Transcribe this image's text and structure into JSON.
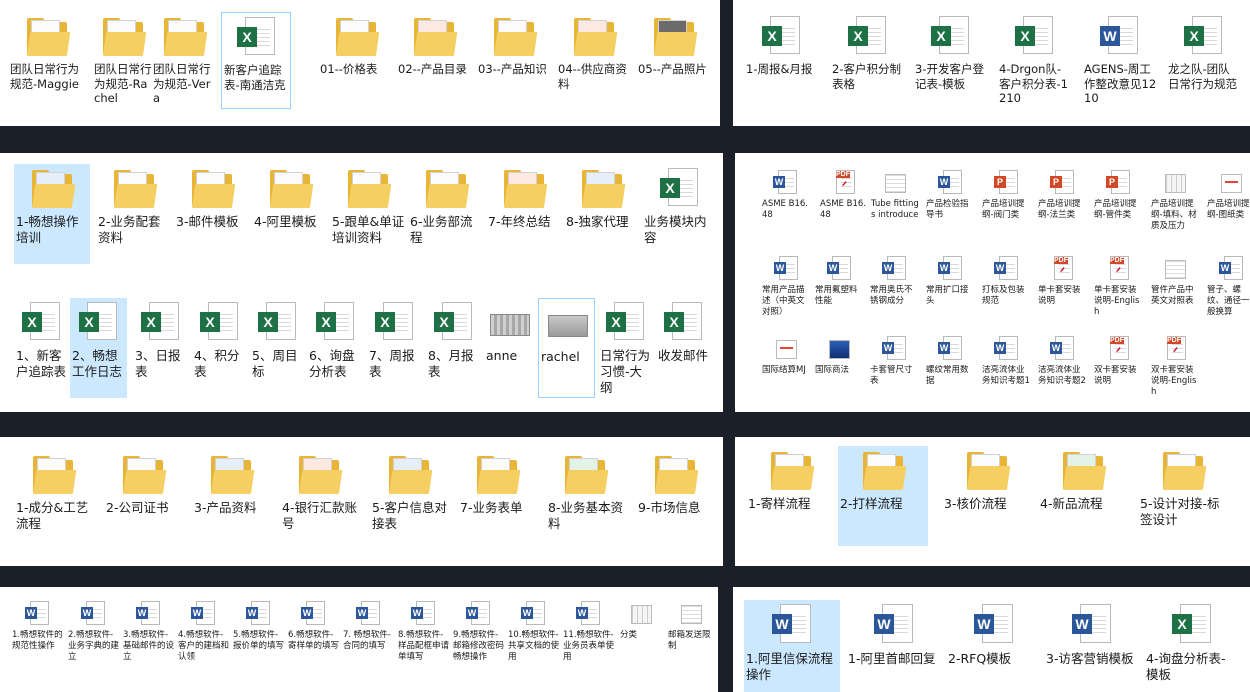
{
  "panels": [
    {
      "id": "p1",
      "items": [
        {
          "label": "团队日常行为规范-Maggie",
          "icon": "folder",
          "paper": "",
          "icon-name": "folder-icon"
        },
        {
          "label": "团队日常行为规范-Rachel",
          "icon": "folder",
          "paper": "",
          "icon-name": "folder-icon"
        },
        {
          "label": "团队日常行为规范-Vera",
          "icon": "folder",
          "paper": "",
          "icon-name": "folder-icon"
        },
        {
          "label": "新客户追踪表-南通洁克",
          "icon": "excel",
          "icon-name": "excel-file-icon",
          "box": true
        },
        {
          "label": "01--价格表",
          "icon": "folder",
          "paper": "",
          "icon-name": "folder-icon"
        },
        {
          "label": "02--产品目录",
          "icon": "folder",
          "paper": "red",
          "icon-name": "folder-icon"
        },
        {
          "label": "03--产品知识",
          "icon": "folder",
          "paper": "",
          "icon-name": "folder-icon"
        },
        {
          "label": "04--供应商资料",
          "icon": "folder",
          "paper": "red",
          "icon-name": "folder-icon"
        },
        {
          "label": "05--产品照片",
          "icon": "folder",
          "paper": "dark",
          "icon-name": "folder-icon"
        }
      ]
    },
    {
      "id": "p2",
      "items": [
        {
          "label": "1-周报&月报",
          "icon": "excel",
          "icon-name": "excel-file-icon"
        },
        {
          "label": "2-客户积分制表格",
          "icon": "excel",
          "icon-name": "excel-file-icon"
        },
        {
          "label": "3-开发客户登记表-模板",
          "icon": "excel",
          "icon-name": "excel-file-icon"
        },
        {
          "label": "4-Drgon队-客户积分表-1210",
          "icon": "excel",
          "icon-name": "excel-file-icon"
        },
        {
          "label": "AGENS-周工作整改意见1210",
          "icon": "word",
          "icon-name": "word-file-icon"
        },
        {
          "label": "龙之队-团队日常行为规范",
          "icon": "excel",
          "icon-name": "excel-file-icon"
        }
      ]
    },
    {
      "id": "p3",
      "items": [
        {
          "label": "1-畅想操作培训",
          "icon": "folder",
          "paper": "blue",
          "icon-name": "folder-icon",
          "sel": true
        },
        {
          "label": "2-业务配套资料",
          "icon": "folder",
          "paper": "",
          "icon-name": "folder-icon"
        },
        {
          "label": "3-邮件模板",
          "icon": "folder",
          "paper": "",
          "icon-name": "folder-icon"
        },
        {
          "label": "4-阿里模板",
          "icon": "folder",
          "paper": "",
          "icon-name": "folder-icon"
        },
        {
          "label": "5-跟单&单证培训资料",
          "icon": "folder",
          "paper": "",
          "icon-name": "folder-icon"
        },
        {
          "label": "6-业务部流程",
          "icon": "folder",
          "paper": "",
          "icon-name": "folder-icon"
        },
        {
          "label": "7-年终总结",
          "icon": "folder",
          "paper": "red",
          "icon-name": "folder-icon"
        },
        {
          "label": "8-独家代理",
          "icon": "folder",
          "paper": "blue",
          "icon-name": "folder-icon"
        },
        {
          "label": "业务模块内容",
          "icon": "excel",
          "icon-name": "excel-file-icon"
        },
        {
          "label": "1、新客户追踪表",
          "icon": "excel",
          "icon-name": "excel-file-icon"
        },
        {
          "label": "2、畅想工作日志",
          "icon": "excel",
          "icon-name": "excel-file-icon",
          "sel": true
        },
        {
          "label": "3、日报表",
          "icon": "excel",
          "icon-name": "excel-file-icon"
        },
        {
          "label": "4、积分表",
          "icon": "excel",
          "icon-name": "excel-file-icon"
        },
        {
          "label": "5、周目标",
          "icon": "excel",
          "icon-name": "excel-file-icon"
        },
        {
          "label": "6、询盘分析表",
          "icon": "excel",
          "icon-name": "excel-file-icon"
        },
        {
          "label": "7、周报表",
          "icon": "excel",
          "icon-name": "excel-file-icon"
        },
        {
          "label": "8、月报表",
          "icon": "excel",
          "icon-name": "excel-file-icon"
        },
        {
          "label": "anne",
          "icon": "image",
          "icon-name": "image-file-icon"
        },
        {
          "label": "rachel",
          "icon": "image",
          "icon-name": "image-file-icon",
          "box": true
        },
        {
          "label": "日常行为习惯-大纲",
          "icon": "excel",
          "icon-name": "excel-file-icon"
        },
        {
          "label": "收发邮件",
          "icon": "excel",
          "icon-name": "excel-file-icon"
        }
      ]
    },
    {
      "id": "p4",
      "items": [
        {
          "label": "ASME B16.48",
          "icon": "word",
          "icon-name": "word-file-icon"
        },
        {
          "label": "ASME B16.48",
          "icon": "pdf",
          "icon-name": "pdf-file-icon"
        },
        {
          "label": "Tube fittings introduce",
          "icon": "thumb",
          "thumb": "grid",
          "icon-name": "image-file-icon"
        },
        {
          "label": "产品检验指导书",
          "icon": "word",
          "icon-name": "word-file-icon"
        },
        {
          "label": "产品培训提纲-阀门类",
          "icon": "ppt",
          "icon-name": "ppt-file-icon"
        },
        {
          "label": "产品培训提纲-法兰类",
          "icon": "ppt",
          "icon-name": "ppt-file-icon"
        },
        {
          "label": "产品培训提纲-管件类",
          "icon": "ppt",
          "icon-name": "ppt-file-icon"
        },
        {
          "label": "产品培训提纲-填料、材质及压力",
          "icon": "thumb",
          "thumb": "grid2",
          "icon-name": "image-file-icon"
        },
        {
          "label": "产品培训提纲-图纸类",
          "icon": "thumb",
          "thumb": "ppt",
          "icon-name": "ppt-file-icon"
        },
        {
          "label": "常用产品描述（中英文对照）",
          "icon": "word",
          "icon-name": "word-file-icon"
        },
        {
          "label": "常用氟塑料性能",
          "icon": "word",
          "icon-name": "word-file-icon"
        },
        {
          "label": "常用奥氏不锈钢成分",
          "icon": "word",
          "icon-name": "word-file-icon"
        },
        {
          "label": "常用扩口接头",
          "icon": "word",
          "icon-name": "word-file-icon"
        },
        {
          "label": "打标及包装规范",
          "icon": "word",
          "icon-name": "word-file-icon"
        },
        {
          "label": "单卡套安装说明",
          "icon": "pdf",
          "icon-name": "pdf-file-icon"
        },
        {
          "label": "单卡套安装说明-English",
          "icon": "pdf",
          "icon-name": "pdf-file-icon"
        },
        {
          "label": "管件产品中英文对照表",
          "icon": "thumb",
          "thumb": "grid",
          "icon-name": "image-file-icon"
        },
        {
          "label": "管子、螺纹、通径一般换算",
          "icon": "word",
          "icon-name": "word-file-icon"
        },
        {
          "label": "国际结算MJ",
          "icon": "thumb",
          "thumb": "ppt",
          "icon-name": "ppt-file-icon"
        },
        {
          "label": "国际商法",
          "icon": "thumb",
          "thumb": "blue",
          "icon-name": "ppt-file-icon"
        },
        {
          "label": "卡套管尺寸表",
          "icon": "word",
          "icon-name": "word-file-icon"
        },
        {
          "label": "螺纹常用数据",
          "icon": "word",
          "icon-name": "word-file-icon"
        },
        {
          "label": "洁亮流体业务知识考题1",
          "icon": "word",
          "icon-name": "word-file-icon"
        },
        {
          "label": "洁亮流体业务知识考题2",
          "icon": "word",
          "icon-name": "word-file-icon"
        },
        {
          "label": "双卡套安装说明",
          "icon": "pdf",
          "icon-name": "pdf-file-icon"
        },
        {
          "label": "双卡套安装说明-English",
          "icon": "pdf",
          "icon-name": "pdf-file-icon"
        }
      ]
    },
    {
      "id": "p5",
      "items": [
        {
          "label": "1-成分&工艺流程",
          "icon": "folder",
          "paper": "",
          "icon-name": "folder-icon"
        },
        {
          "label": "2-公司证书",
          "icon": "folder",
          "paper": "",
          "icon-name": "folder-icon"
        },
        {
          "label": "3-产品资料",
          "icon": "folder",
          "paper": "blue",
          "icon-name": "folder-icon"
        },
        {
          "label": "4-银行汇款账号",
          "icon": "folder",
          "paper": "red",
          "icon-name": "folder-icon"
        },
        {
          "label": "5-客户信息对接表",
          "icon": "folder",
          "paper": "blue",
          "icon-name": "folder-icon"
        },
        {
          "label": "7-业务表单",
          "icon": "folder",
          "paper": "",
          "icon-name": "folder-icon"
        },
        {
          "label": "8-业务基本资料",
          "icon": "folder",
          "paper": "green",
          "icon-name": "folder-icon"
        },
        {
          "label": "9-市场信息",
          "icon": "folder",
          "paper": "",
          "icon-name": "folder-icon"
        }
      ]
    },
    {
      "id": "p6",
      "items": [
        {
          "label": "1-寄样流程",
          "icon": "folder",
          "paper": "",
          "icon-name": "folder-icon"
        },
        {
          "label": "2-打样流程",
          "icon": "folder",
          "paper": "",
          "icon-name": "folder-icon",
          "sel": true
        },
        {
          "label": "3-核价流程",
          "icon": "folder",
          "paper": "",
          "icon-name": "folder-icon"
        },
        {
          "label": "4-新品流程",
          "icon": "folder",
          "paper": "green",
          "icon-name": "folder-icon"
        },
        {
          "label": "5-设计对接-标签设计",
          "icon": "folder",
          "paper": "",
          "icon-name": "folder-icon"
        }
      ]
    },
    {
      "id": "p7",
      "items": [
        {
          "label": "1.畅想软件的规范性操作",
          "icon": "word",
          "icon-name": "word-file-icon"
        },
        {
          "label": "2.畅想软件-业务字典的建立",
          "icon": "word",
          "icon-name": "word-file-icon"
        },
        {
          "label": "3.畅想软件-基础邮件的设立",
          "icon": "word",
          "icon-name": "word-file-icon"
        },
        {
          "label": "4.畅想软件-客户的建档和认领",
          "icon": "word",
          "icon-name": "word-file-icon"
        },
        {
          "label": "5.畅想软件-报价单的填写",
          "icon": "word",
          "icon-name": "word-file-icon"
        },
        {
          "label": "6.畅想软件-寄样单的填写",
          "icon": "word",
          "icon-name": "word-file-icon"
        },
        {
          "label": "7. 畅想软件-合同的填写",
          "icon": "word",
          "icon-name": "word-file-icon"
        },
        {
          "label": "8.畅想软件-样品配框申请单填写",
          "icon": "word",
          "icon-name": "word-file-icon"
        },
        {
          "label": "9.畅想软件-邮箱修改密码畅想操作",
          "icon": "word",
          "icon-name": "word-file-icon"
        },
        {
          "label": "10.畅想软件-共享文档的使用",
          "icon": "word",
          "icon-name": "word-file-icon"
        },
        {
          "label": "11.畅想软件-业务员表单使用",
          "icon": "word",
          "icon-name": "word-file-icon"
        },
        {
          "label": "分类",
          "icon": "thumb",
          "thumb": "grid2",
          "icon-name": "image-file-icon"
        },
        {
          "label": "邮箱发送限制",
          "icon": "thumb",
          "thumb": "grid",
          "icon-name": "image-file-icon"
        }
      ]
    },
    {
      "id": "p8",
      "items": [
        {
          "label": "1.阿里信保流程操作",
          "icon": "word",
          "icon-name": "word-file-icon",
          "sel": true
        },
        {
          "label": "1-阿里首邮回复",
          "icon": "word",
          "icon-name": "word-file-icon"
        },
        {
          "label": "2-RFQ模板",
          "icon": "word",
          "icon-name": "word-file-icon"
        },
        {
          "label": "3-访客营销模板",
          "icon": "word",
          "icon-name": "word-file-icon"
        },
        {
          "label": "4-询盘分析表- 模板",
          "icon": "excel",
          "icon-name": "excel-file-icon"
        }
      ]
    }
  ],
  "badges": {
    "excel": "X",
    "word": "W",
    "ppt": "P",
    "pdf": "PDF"
  }
}
